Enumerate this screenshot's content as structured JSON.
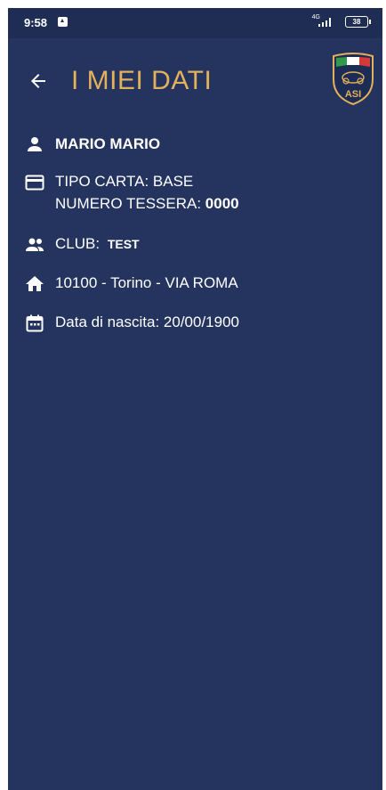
{
  "status_bar": {
    "time": "9:58",
    "network": "4G",
    "battery": "38",
    "icons": [
      "notification-icon",
      "signal-icon",
      "battery-icon"
    ]
  },
  "header": {
    "title": "I MIEI DATI",
    "back_icon": "arrow-left-icon",
    "logo": "asi-shield-logo",
    "logo_text": "ASI"
  },
  "profile": {
    "name": "MARIO MARIO",
    "card_type_label": "TIPO CARTA:",
    "card_type_value": "BASE",
    "card_number_label": "NUMERO TESSERA:",
    "card_number_value": "0000",
    "club_label": "CLUB:",
    "club_value": "TEST",
    "address": "10100 - Torino - VIA ROMA",
    "birth_label": "Data di nascita:",
    "birth_value": "20/00/1900"
  },
  "colors": {
    "background": "#24345f",
    "status_bar": "#1f2d55",
    "title": "#e3b05c",
    "text": "#ffffff"
  }
}
